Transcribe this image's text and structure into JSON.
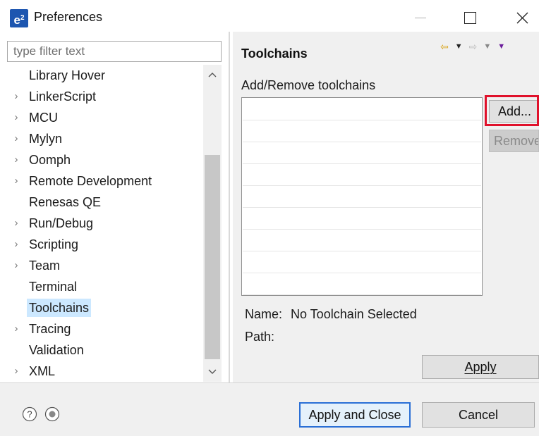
{
  "window": {
    "logo_text": "e",
    "logo_sup": "2",
    "title": "Preferences"
  },
  "left_pane": {
    "filter_placeholder": "type filter text",
    "tree_items": [
      {
        "label": "Library Hover",
        "expandable": false,
        "selected": false
      },
      {
        "label": "LinkerScript",
        "expandable": true,
        "selected": false
      },
      {
        "label": "MCU",
        "expandable": true,
        "selected": false
      },
      {
        "label": "Mylyn",
        "expandable": true,
        "selected": false
      },
      {
        "label": "Oomph",
        "expandable": true,
        "selected": false
      },
      {
        "label": "Remote Development",
        "expandable": true,
        "selected": false
      },
      {
        "label": "Renesas QE",
        "expandable": false,
        "selected": false
      },
      {
        "label": "Run/Debug",
        "expandable": true,
        "selected": false
      },
      {
        "label": "Scripting",
        "expandable": true,
        "selected": false
      },
      {
        "label": "Team",
        "expandable": true,
        "selected": false
      },
      {
        "label": "Terminal",
        "expandable": false,
        "selected": false
      },
      {
        "label": "Toolchains",
        "expandable": false,
        "selected": true
      },
      {
        "label": "Tracing",
        "expandable": true,
        "selected": false
      },
      {
        "label": "Validation",
        "expandable": false,
        "selected": false
      },
      {
        "label": "XML",
        "expandable": true,
        "selected": false
      }
    ]
  },
  "right_pane": {
    "title": "Toolchains",
    "section_label": "Add/Remove toolchains",
    "add_button": "Add...",
    "remove_button": "Remove",
    "name_label": "Name:",
    "name_value": "No Toolchain Selected",
    "path_label": "Path:",
    "apply_button": "Apply",
    "list_rows": 9
  },
  "footer": {
    "apply_close_button": "Apply and Close",
    "cancel_button": "Cancel"
  },
  "colors": {
    "accent": "#2a6fd6",
    "highlight": "#e0112b",
    "selection": "#cce8ff",
    "logo": "#1d56b0"
  }
}
